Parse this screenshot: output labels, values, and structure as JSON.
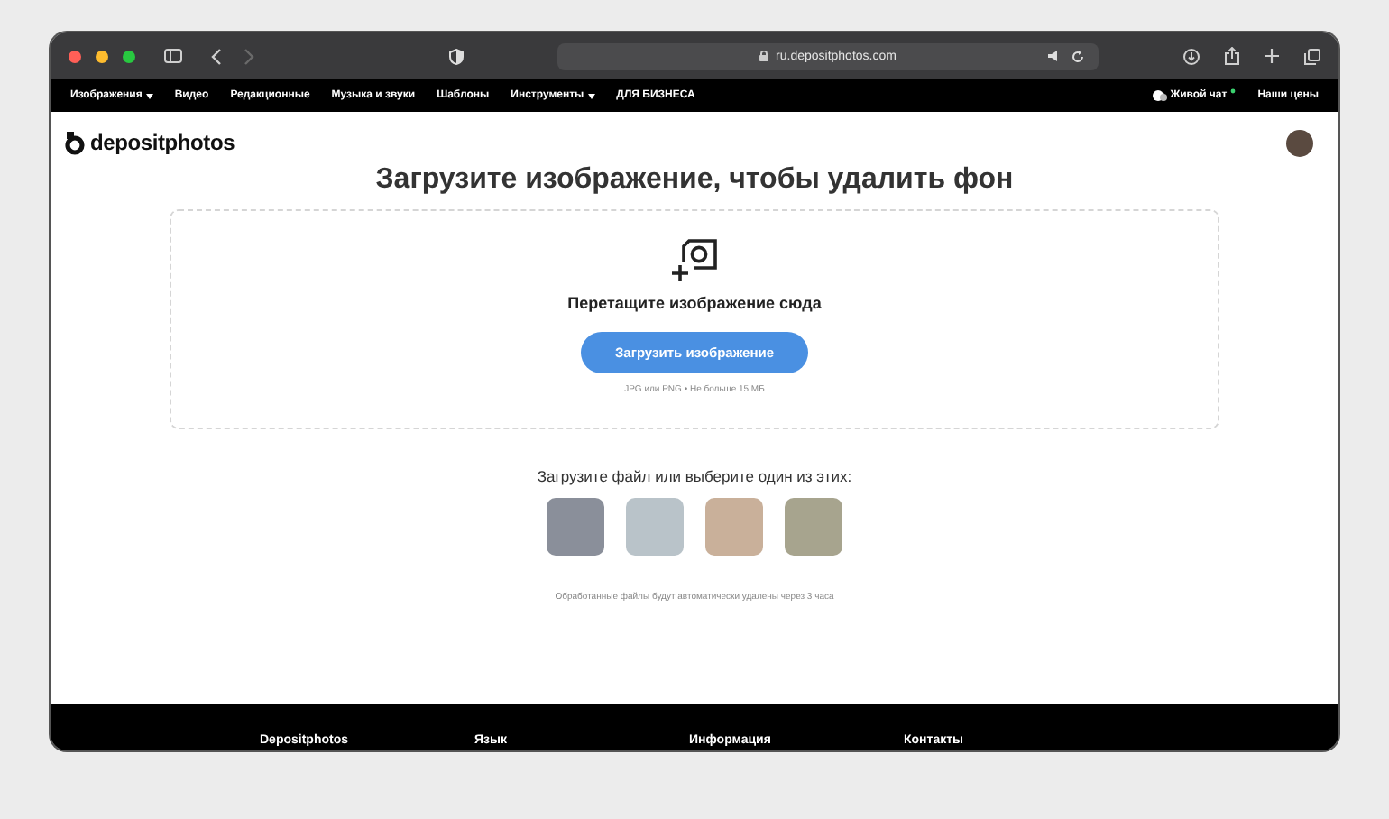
{
  "browser": {
    "url": "ru.depositphotos.com"
  },
  "nav": {
    "items": [
      {
        "label": "Изображения",
        "dropdown": true
      },
      {
        "label": "Видео",
        "dropdown": false
      },
      {
        "label": "Редакционные",
        "dropdown": false
      },
      {
        "label": "Музыка и звуки",
        "dropdown": false
      },
      {
        "label": "Шаблоны",
        "dropdown": false
      },
      {
        "label": "Инструменты",
        "dropdown": true
      },
      {
        "label": "ДЛЯ БИЗНЕСА",
        "dropdown": false
      }
    ],
    "live_chat": "Живой чат",
    "prices": "Наши цены"
  },
  "header": {
    "logo": "depositphotos"
  },
  "title": "Загрузите изображение, чтобы удалить фон",
  "dropzone": {
    "prompt": "Перетащите изображение сюда",
    "button": "Загрузить изображение",
    "hint": "JPG или PNG • Не больше 15 МБ"
  },
  "samples": {
    "heading": "Загрузите файл или выберите один из этих:",
    "items": [
      {
        "color": "#8a8f9a"
      },
      {
        "color": "#b9c3c9"
      },
      {
        "color": "#c9b09a"
      },
      {
        "color": "#a7a48e"
      }
    ]
  },
  "note": "Обработанные файлы будут автоматически удалены через 3 часа",
  "footer": {
    "columns": [
      "Depositphotos",
      "Язык",
      "Информация",
      "Контакты"
    ]
  }
}
